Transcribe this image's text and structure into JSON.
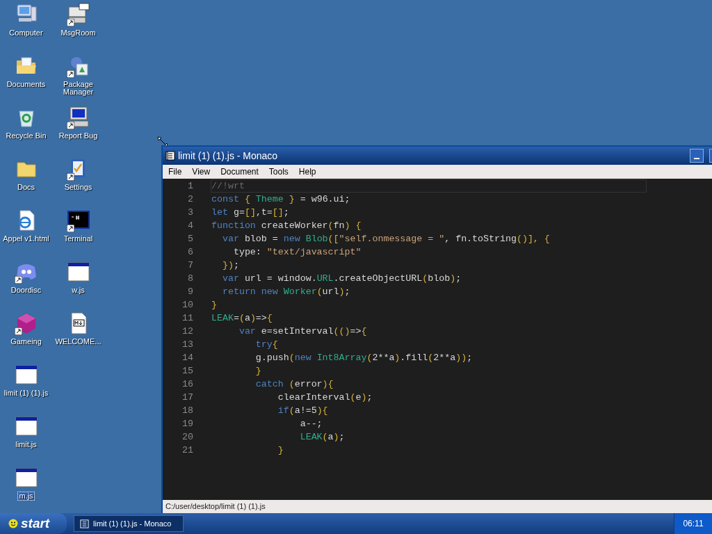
{
  "desktop": {
    "icons": [
      {
        "label": "Computer",
        "kind": "computer",
        "shortcut": false,
        "selected": false
      },
      {
        "label": "Documents",
        "kind": "folder-open",
        "shortcut": false,
        "selected": false
      },
      {
        "label": "Recycle Bin",
        "kind": "recycle",
        "shortcut": false,
        "selected": false
      },
      {
        "label": "Docs",
        "kind": "folder",
        "shortcut": false,
        "selected": false
      },
      {
        "label": "Appel v1.html",
        "kind": "web",
        "shortcut": false,
        "selected": false
      },
      {
        "label": "Doordisc",
        "kind": "chat",
        "shortcut": true,
        "selected": false
      },
      {
        "label": "Gameing",
        "kind": "cube",
        "shortcut": true,
        "selected": false
      },
      {
        "label": "limit (1) (1).js",
        "kind": "window",
        "shortcut": false,
        "selected": false
      },
      {
        "label": "limit.js",
        "kind": "window",
        "shortcut": false,
        "selected": false
      },
      {
        "label": "m.js",
        "kind": "window",
        "shortcut": false,
        "selected": true
      },
      {
        "label": "MsgRoom",
        "kind": "message",
        "shortcut": true,
        "selected": false
      },
      {
        "label": "Package Manager",
        "kind": "package",
        "shortcut": true,
        "selected": false
      },
      {
        "label": "Report Bug",
        "kind": "monitor",
        "shortcut": true,
        "selected": false
      },
      {
        "label": "Settings",
        "kind": "settings",
        "shortcut": true,
        "selected": false
      },
      {
        "label": "Terminal",
        "kind": "terminal",
        "shortcut": true,
        "selected": false
      },
      {
        "label": "w.js",
        "kind": "window",
        "shortcut": false,
        "selected": false
      },
      {
        "label": "WELCOME...",
        "kind": "markdown",
        "shortcut": false,
        "selected": false
      }
    ]
  },
  "window": {
    "title": "limit (1) (1).js - Monaco",
    "menu": [
      "File",
      "View",
      "Document",
      "Tools",
      "Help"
    ],
    "editor": {
      "lines": [
        {
          "number": "1",
          "current": true,
          "tokens": [
            {
              "kind": "cm",
              "text": "//!wrt"
            }
          ]
        },
        {
          "number": "2",
          "current": false,
          "tokens": [
            {
              "kind": "kw",
              "text": "const"
            },
            {
              "kind": "br",
              "text": " { "
            },
            {
              "kind": "cls",
              "text": "Theme"
            },
            {
              "kind": "br",
              "text": " }"
            },
            {
              "kind": "pl",
              "text": " = w96.ui;"
            }
          ]
        },
        {
          "number": "3",
          "current": false,
          "tokens": [
            {
              "kind": "kw",
              "text": "let"
            },
            {
              "kind": "pl",
              "text": " g="
            },
            {
              "kind": "br",
              "text": "[]"
            },
            {
              "kind": "pl",
              "text": ",t="
            },
            {
              "kind": "br",
              "text": "[]"
            },
            {
              "kind": "pl",
              "text": ";"
            }
          ]
        },
        {
          "number": "4",
          "current": false,
          "tokens": [
            {
              "kind": "kw",
              "text": "function"
            },
            {
              "kind": "pl",
              "text": " createWorker"
            },
            {
              "kind": "br",
              "text": "("
            },
            {
              "kind": "pl",
              "text": "fn"
            },
            {
              "kind": "br",
              "text": ") {"
            }
          ]
        },
        {
          "number": "5",
          "current": false,
          "tokens": [
            {
              "kind": "kw",
              "text": "  var"
            },
            {
              "kind": "pl",
              "text": " blob = "
            },
            {
              "kind": "kw",
              "text": "new"
            },
            {
              "kind": "cls",
              "text": " Blob"
            },
            {
              "kind": "br",
              "text": "(["
            },
            {
              "kind": "str",
              "text": "\"self.onmessage = \""
            },
            {
              "kind": "pl",
              "text": ", fn.toString"
            },
            {
              "kind": "br",
              "text": "()], {"
            }
          ]
        },
        {
          "number": "6",
          "current": false,
          "tokens": [
            {
              "kind": "pl",
              "text": "    type: "
            },
            {
              "kind": "str",
              "text": "\"text/javascript\""
            }
          ]
        },
        {
          "number": "7",
          "current": false,
          "tokens": [
            {
              "kind": "br",
              "text": "  })"
            },
            {
              "kind": "pl",
              "text": ";"
            }
          ]
        },
        {
          "number": "8",
          "current": false,
          "tokens": [
            {
              "kind": "kw",
              "text": "  var"
            },
            {
              "kind": "pl",
              "text": " url = window."
            },
            {
              "kind": "cls",
              "text": "URL"
            },
            {
              "kind": "pl",
              "text": ".createObjectURL"
            },
            {
              "kind": "br",
              "text": "("
            },
            {
              "kind": "pl",
              "text": "blob"
            },
            {
              "kind": "br",
              "text": ")"
            },
            {
              "kind": "pl",
              "text": ";"
            }
          ]
        },
        {
          "number": "9",
          "current": false,
          "tokens": [
            {
              "kind": "kw",
              "text": "  return new"
            },
            {
              "kind": "cls",
              "text": " Worker"
            },
            {
              "kind": "br",
              "text": "("
            },
            {
              "kind": "pl",
              "text": "url"
            },
            {
              "kind": "br",
              "text": ")"
            },
            {
              "kind": "pl",
              "text": ";"
            }
          ]
        },
        {
          "number": "10",
          "current": false,
          "tokens": [
            {
              "kind": "br",
              "text": "}"
            }
          ]
        },
        {
          "number": "11",
          "current": false,
          "tokens": [
            {
              "kind": "cls",
              "text": "LEAK"
            },
            {
              "kind": "pl",
              "text": "="
            },
            {
              "kind": "br",
              "text": "("
            },
            {
              "kind": "pl",
              "text": "a"
            },
            {
              "kind": "br",
              "text": ")"
            },
            {
              "kind": "pl",
              "text": "=>"
            },
            {
              "kind": "br",
              "text": "{"
            }
          ]
        },
        {
          "number": "12",
          "current": false,
          "tokens": [
            {
              "kind": "kw",
              "text": "     var"
            },
            {
              "kind": "pl",
              "text": " e=setInterval"
            },
            {
              "kind": "br",
              "text": "(()"
            },
            {
              "kind": "pl",
              "text": "=>"
            },
            {
              "kind": "br",
              "text": "{"
            }
          ]
        },
        {
          "number": "13",
          "current": false,
          "tokens": [
            {
              "kind": "kw",
              "text": "        try"
            },
            {
              "kind": "br",
              "text": "{"
            }
          ]
        },
        {
          "number": "14",
          "current": false,
          "tokens": [
            {
              "kind": "pl",
              "text": "        g.push"
            },
            {
              "kind": "br",
              "text": "("
            },
            {
              "kind": "kw",
              "text": "new"
            },
            {
              "kind": "cls",
              "text": " Int8Array"
            },
            {
              "kind": "br",
              "text": "("
            },
            {
              "kind": "pl",
              "text": "2**a"
            },
            {
              "kind": "br",
              "text": ")"
            },
            {
              "kind": "pl",
              "text": ".fill"
            },
            {
              "kind": "br",
              "text": "("
            },
            {
              "kind": "pl",
              "text": "2**a"
            },
            {
              "kind": "br",
              "text": "))"
            },
            {
              "kind": "pl",
              "text": ";"
            }
          ]
        },
        {
          "number": "15",
          "current": false,
          "tokens": [
            {
              "kind": "br",
              "text": "        }"
            }
          ]
        },
        {
          "number": "16",
          "current": false,
          "tokens": [
            {
              "kind": "kw",
              "text": "        catch"
            },
            {
              "kind": "br",
              "text": " ("
            },
            {
              "kind": "pl",
              "text": "error"
            },
            {
              "kind": "br",
              "text": "){"
            }
          ]
        },
        {
          "number": "17",
          "current": false,
          "tokens": [
            {
              "kind": "pl",
              "text": "            clearInterval"
            },
            {
              "kind": "br",
              "text": "("
            },
            {
              "kind": "pl",
              "text": "e"
            },
            {
              "kind": "br",
              "text": ")"
            },
            {
              "kind": "pl",
              "text": ";"
            }
          ]
        },
        {
          "number": "18",
          "current": false,
          "tokens": [
            {
              "kind": "kw",
              "text": "            if"
            },
            {
              "kind": "br",
              "text": "("
            },
            {
              "kind": "pl",
              "text": "a!=5"
            },
            {
              "kind": "br",
              "text": "){"
            }
          ]
        },
        {
          "number": "19",
          "current": false,
          "tokens": [
            {
              "kind": "pl",
              "text": "                a--;"
            }
          ]
        },
        {
          "number": "20",
          "current": false,
          "tokens": [
            {
              "kind": "cls",
              "text": "                LEAK"
            },
            {
              "kind": "br",
              "text": "("
            },
            {
              "kind": "pl",
              "text": "a"
            },
            {
              "kind": "br",
              "text": ")"
            },
            {
              "kind": "pl",
              "text": ";"
            }
          ]
        },
        {
          "number": "21",
          "current": false,
          "tokens": [
            {
              "kind": "br",
              "text": "            }"
            }
          ]
        }
      ]
    },
    "status_bar": "C:/user/desktop/limit (1) (1).js"
  },
  "taskbar": {
    "start": "start",
    "tasks": [
      {
        "label": "limit (1) (1).js - Monaco",
        "selected": true
      }
    ],
    "clock": "06:11"
  }
}
